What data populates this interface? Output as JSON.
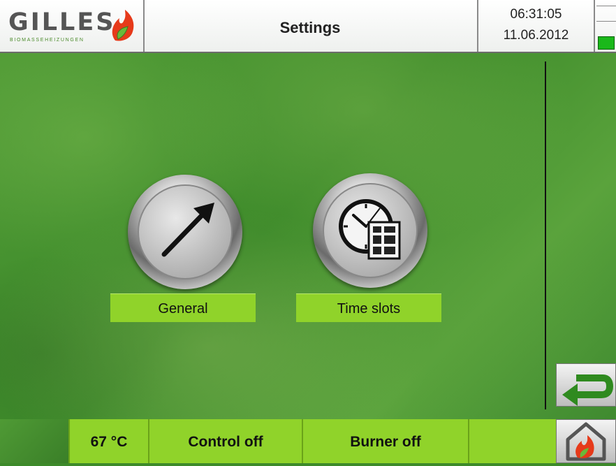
{
  "header": {
    "logo_text": "GILLES",
    "logo_subtitle": "BIOMASSEHEIZUNGEN",
    "title": "Settings",
    "time": "06:31:05",
    "date": "11.06.2012",
    "signal_level": "low"
  },
  "menu": {
    "items": [
      {
        "label": "General",
        "icon": "arrow-icon"
      },
      {
        "label": "Time slots",
        "icon": "clock-window-icon"
      }
    ]
  },
  "footer": {
    "temperature": "67 °C",
    "control_status": "Control off",
    "burner_status": "Burner off",
    "extra_status": ""
  },
  "buttons": {
    "back_icon": "back-arrow-icon",
    "home_icon": "home-flame-icon"
  },
  "colors": {
    "accent_green": "#90d32a",
    "background_green": "#3d8a2a",
    "flame_red": "#e63a1a",
    "signal_green": "#1ab81a"
  }
}
